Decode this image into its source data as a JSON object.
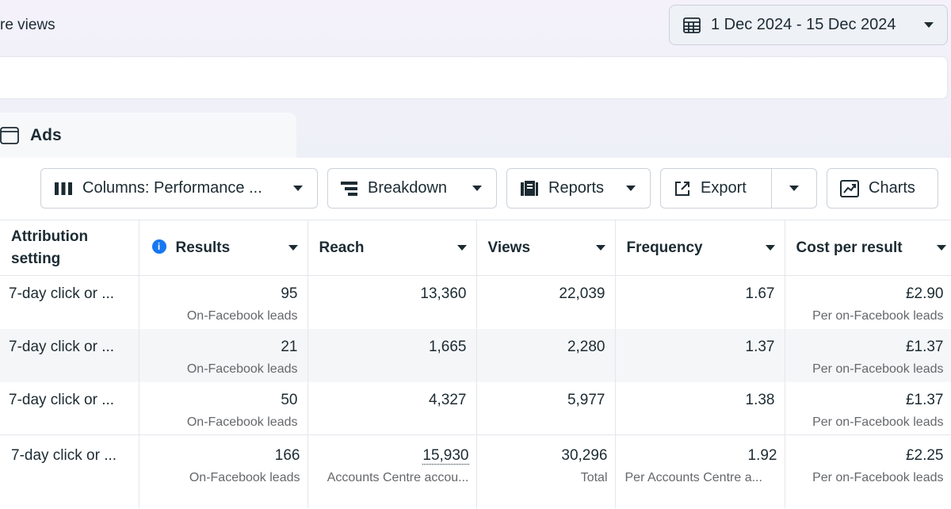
{
  "header": {
    "left_text": "re views",
    "date_range": "1 Dec 2024 - 15 Dec 2024"
  },
  "tab": {
    "label": "Ads"
  },
  "toolbar": {
    "columns_label": "Columns: Performance ...",
    "breakdown_label": "Breakdown",
    "reports_label": "Reports",
    "export_label": "Export",
    "charts_label": "Charts"
  },
  "table": {
    "headers": {
      "attribution": "Attribution setting",
      "results": "Results",
      "reach": "Reach",
      "views": "Views",
      "frequency": "Frequency",
      "cost": "Cost per result"
    },
    "rows": [
      {
        "attribution": "7-day click or ...",
        "results": "95",
        "results_sub": "On-Facebook leads",
        "reach": "13,360",
        "views": "22,039",
        "frequency": "1.67",
        "cost": "£2.90",
        "cost_sub": "Per on-Facebook leads"
      },
      {
        "attribution": "7-day click or ...",
        "results": "21",
        "results_sub": "On-Facebook leads",
        "reach": "1,665",
        "views": "2,280",
        "frequency": "1.37",
        "cost": "£1.37",
        "cost_sub": "Per on-Facebook leads"
      },
      {
        "attribution": "7-day click or ...",
        "results": "50",
        "results_sub": "On-Facebook leads",
        "reach": "4,327",
        "views": "5,977",
        "frequency": "1.38",
        "cost": "£1.37",
        "cost_sub": "Per on-Facebook leads"
      }
    ],
    "total": {
      "attribution": "7-day click or ...",
      "results": "166",
      "results_sub": "On-Facebook leads",
      "reach": "15,930",
      "reach_sub": "Accounts Centre accou...",
      "views": "30,296",
      "views_sub": "Total",
      "frequency": "1.92",
      "frequency_sub": "Per Accounts Centre a...",
      "cost": "£2.25",
      "cost_sub": "Per on-Facebook leads"
    }
  },
  "colors": {
    "accent": "#1877f2",
    "text": "#1c2b33",
    "muted": "#65676b",
    "border": "#cbd2d9"
  }
}
